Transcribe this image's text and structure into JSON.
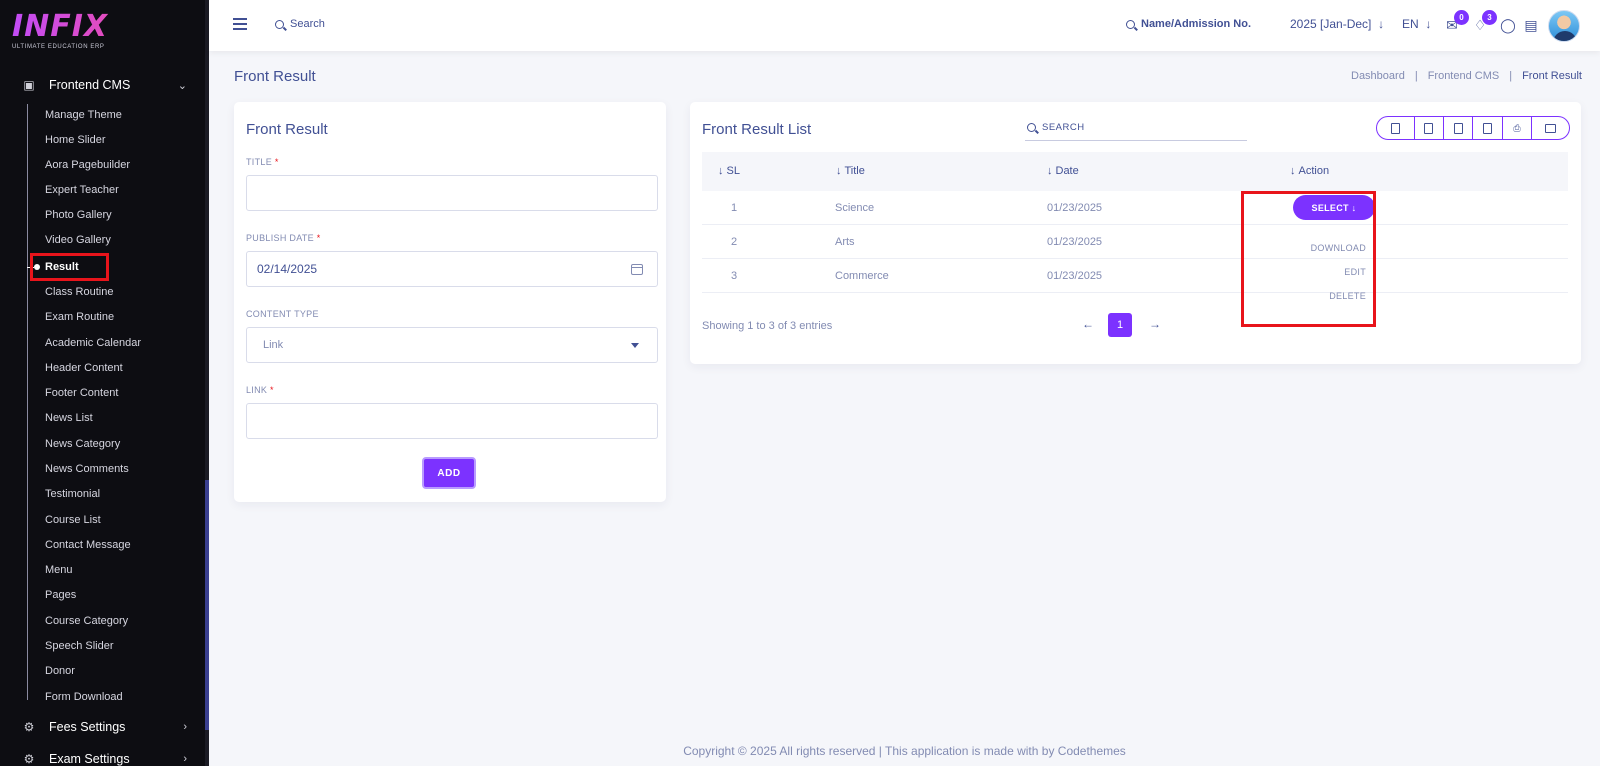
{
  "app": {
    "logo_text": "INFIX",
    "logo_subtitle": "ULTIMATE EDUCATION ERP"
  },
  "sidebar": {
    "active_group": "Frontend CMS",
    "items": [
      "Manage Theme",
      "Home Slider",
      "Aora Pagebuilder",
      "Expert Teacher",
      "Photo Gallery",
      "Video Gallery",
      "Result",
      "Class Routine",
      "Exam Routine",
      "Academic Calendar",
      "Header Content",
      "Footer Content",
      "News List",
      "News Category",
      "News Comments",
      "Testimonial",
      "Course List",
      "Contact Message",
      "Menu",
      "Pages",
      "Course Category",
      "Speech Slider",
      "Donor",
      "Form Download"
    ],
    "active_item": "Result",
    "next_groups": [
      "Fees Settings",
      "Exam Settings"
    ]
  },
  "header": {
    "search_label": "Search",
    "name_search_label": "Name/Admission No.",
    "academic_year": "2025 [Jan-Dec]",
    "language": "EN",
    "messages_count": "0",
    "notifications_count": "3"
  },
  "page": {
    "title": "Front Result",
    "breadcrumb": [
      "Dashboard",
      "Frontend CMS",
      "Front Result"
    ]
  },
  "form": {
    "title": "Front Result",
    "title_label": "TITLE",
    "title_value": "",
    "publish_date_label": "PUBLISH DATE",
    "publish_date_value": "02/14/2025",
    "content_type_label": "CONTENT TYPE",
    "content_type_value": "Link",
    "link_label": "LINK",
    "link_value": "",
    "required_mark": "*",
    "add_button": "ADD"
  },
  "list": {
    "title": "Front Result List",
    "search_placeholder": "SEARCH",
    "columns": [
      "SL",
      "Title",
      "Date",
      "Action"
    ],
    "rows": [
      {
        "sl": "1",
        "title": "Science",
        "date": "01/23/2025"
      },
      {
        "sl": "2",
        "title": "Arts",
        "date": "01/23/2025"
      },
      {
        "sl": "3",
        "title": "Commerce",
        "date": "01/23/2025"
      }
    ],
    "select_button": "SELECT",
    "dropdown": [
      "DOWNLOAD",
      "EDIT",
      "DELETE"
    ],
    "showing_text": "Showing 1 to 3 of 3 entries",
    "current_page": "1"
  },
  "footer": {
    "text": "Copyright © 2025 All rights reserved | This application is made with by Codethemes"
  },
  "colors": {
    "accent": "#7c32ff",
    "text_primary": "#415094",
    "text_muted": "#828bb2",
    "highlight_box": "#e8141b",
    "sidebar_bg": "#0d0d12"
  }
}
